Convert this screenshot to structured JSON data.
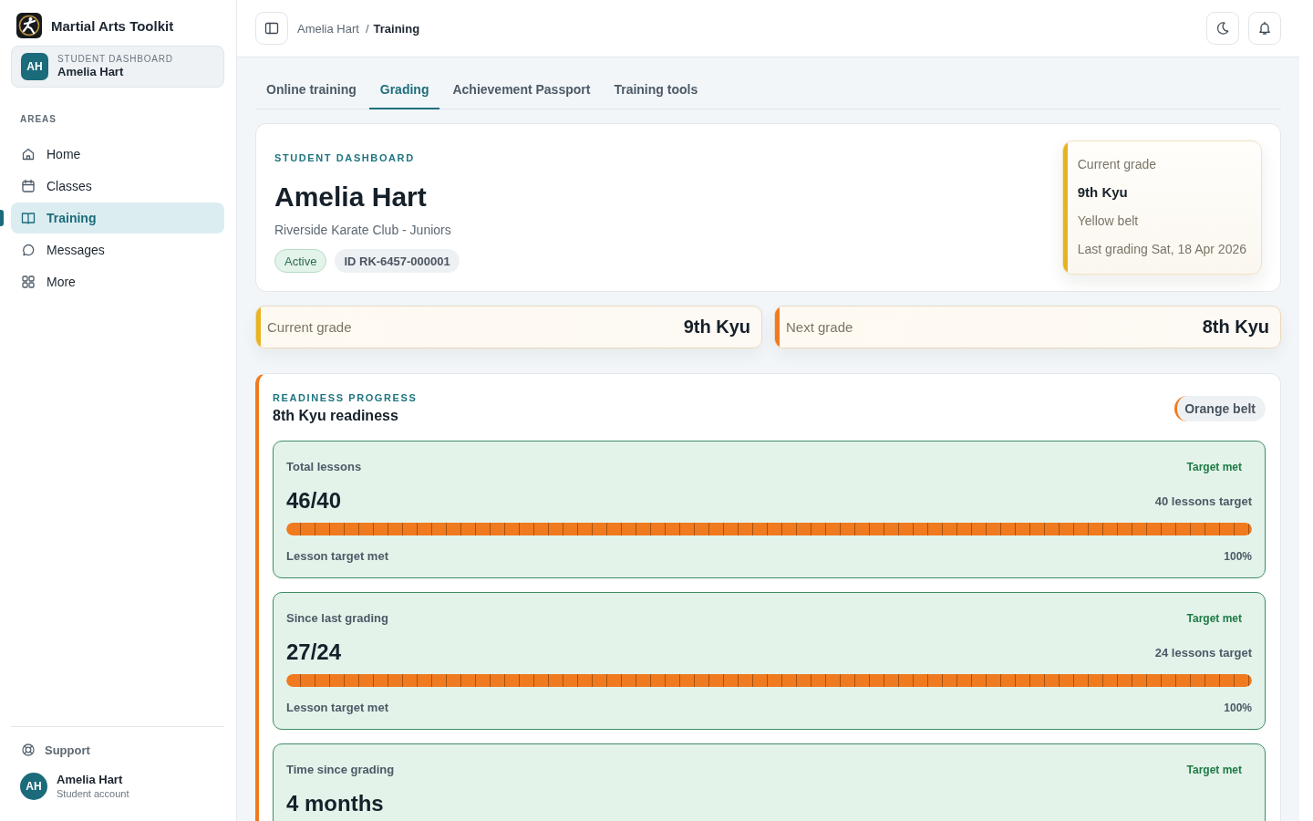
{
  "sidebar": {
    "app_name": "Martial Arts Toolkit",
    "switcher": {
      "initials": "AH",
      "label": "STUDENT DASHBOARD",
      "name": "Amelia Hart"
    },
    "section_label": "AREAS",
    "items": [
      {
        "label": "Home",
        "selected": false
      },
      {
        "label": "Classes",
        "selected": false
      },
      {
        "label": "Training",
        "selected": true
      },
      {
        "label": "Messages",
        "selected": false
      },
      {
        "label": "More",
        "selected": false
      }
    ],
    "support": "Support",
    "account": {
      "initials": "AH",
      "name": "Amelia Hart",
      "role": "Student account"
    }
  },
  "header": {
    "breadcrumb": [
      {
        "label": "Amelia Hart",
        "current": false
      },
      {
        "label": "Training",
        "current": true
      }
    ],
    "separator": "/"
  },
  "tabs": [
    {
      "label": "Online training",
      "selected": false
    },
    {
      "label": "Grading",
      "selected": true
    },
    {
      "label": "Achievement Passport",
      "selected": false
    },
    {
      "label": "Training tools",
      "selected": false
    }
  ],
  "profile": {
    "eyebrow": "STUDENT DASHBOARD",
    "name": "Amelia Hart",
    "club": "Riverside Karate Club - Juniors",
    "status": "Active",
    "id": "ID RK-6457-000001",
    "grade_panel": {
      "label": "Current grade",
      "grade": "9th Kyu",
      "belt": "Yellow belt",
      "last_grading": "Last grading Sat, 18 Apr 2026"
    }
  },
  "grade_summary": [
    {
      "label": "Current grade",
      "value": "9th Kyu",
      "color": "#e8b422"
    },
    {
      "label": "Next grade",
      "value": "8th Kyu",
      "color": "#f07a1f"
    }
  ],
  "readiness": {
    "eyebrow": "READINESS PROGRESS",
    "title": "8th Kyu readiness",
    "belt": "Orange belt",
    "metrics": [
      {
        "title": "Total lessons",
        "status": "Target met",
        "value": "46/40",
        "target": "40 lessons target",
        "level": 1,
        "footer": "Lesson target met",
        "percent": "100%"
      },
      {
        "title": "Since last grading",
        "status": "Target met",
        "value": "27/24",
        "target": "24 lessons target",
        "level": 1,
        "footer": "Lesson target met",
        "percent": "100%"
      },
      {
        "title": "Time since grading",
        "status": "Target met",
        "value": "4 months"
      }
    ]
  }
}
